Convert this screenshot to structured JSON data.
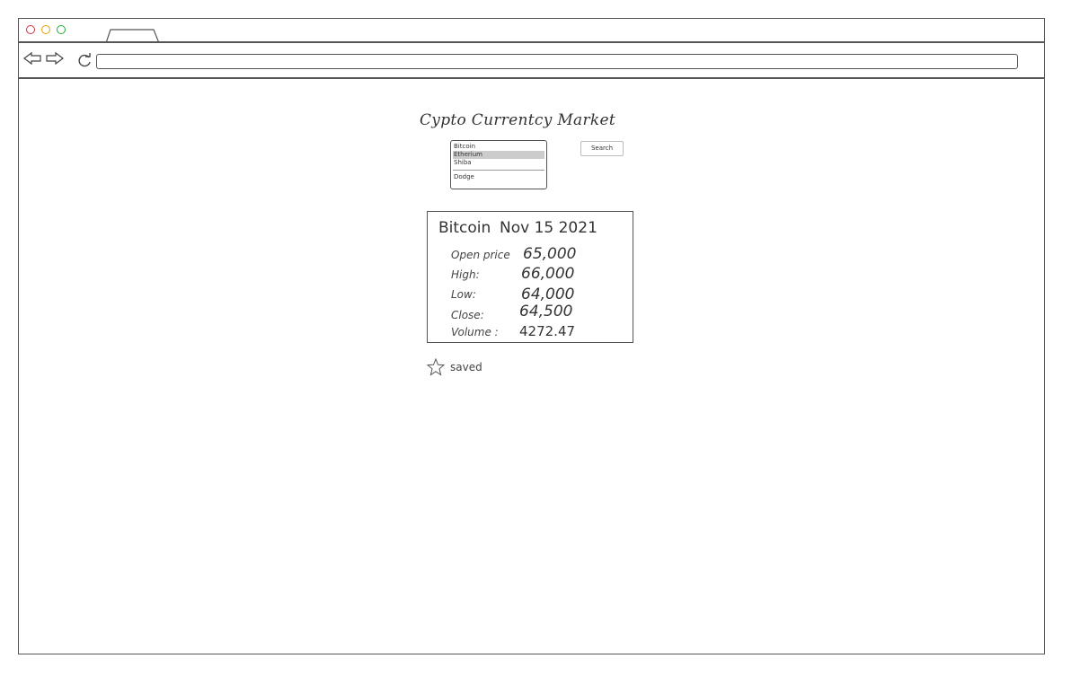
{
  "browser": {
    "window_controls": {
      "close_color": "#cc3344",
      "minimize_color": "#e6a000",
      "maximize_color": "#22aa33"
    },
    "address_bar": {
      "value": ""
    }
  },
  "page": {
    "title": "Cypto Currentcy Market",
    "coin_list": {
      "options": [
        "Bitcoin",
        "Etherium",
        "Shiba",
        "Dodge"
      ],
      "selected": "Etherium"
    },
    "search_label": "Search"
  },
  "card": {
    "coin": "Bitcoin",
    "date": "Nov 15 2021",
    "rows": [
      {
        "label": "Open price",
        "value": "65,000"
      },
      {
        "label": "High:",
        "value": "66,000"
      },
      {
        "label": "Low:",
        "value": "64,000"
      },
      {
        "label": "Close:",
        "value": "64,500"
      },
      {
        "label": "Volume :",
        "value": "4272.47"
      }
    ]
  },
  "saved": {
    "label": "saved",
    "icon": "star-icon"
  }
}
